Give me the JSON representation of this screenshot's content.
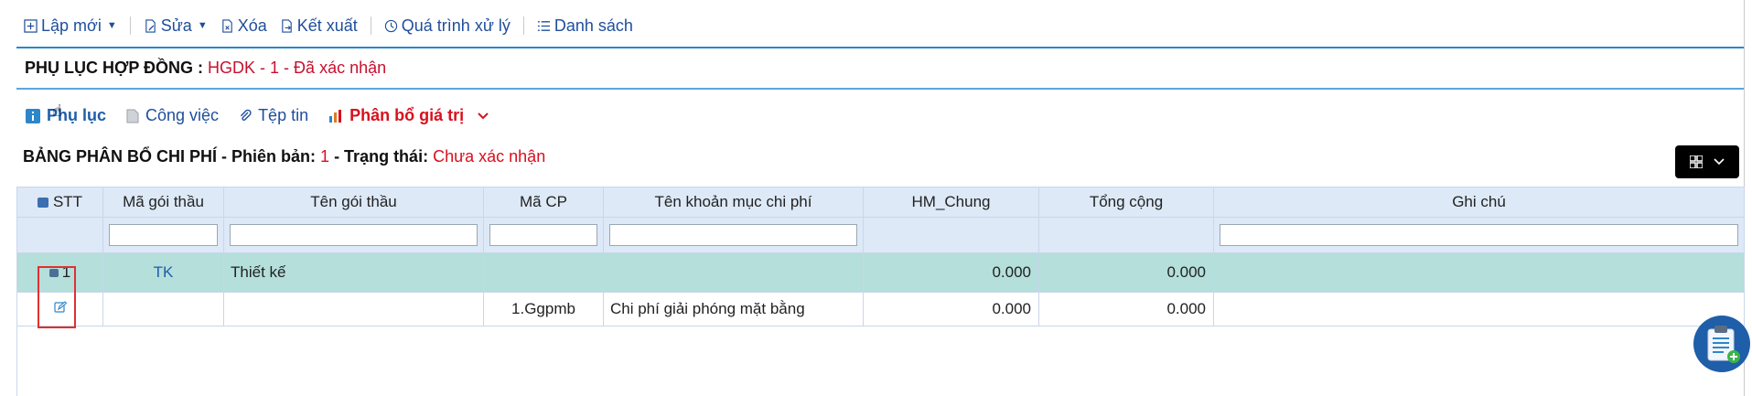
{
  "toolbar": {
    "new_label": "Lập mới",
    "edit_label": "Sửa",
    "delete_label": "Xóa",
    "export_label": "Kết xuất",
    "process_label": "Quá trình xử lý",
    "list_label": "Danh sách"
  },
  "contract": {
    "label": "PHỤ LỤC HỢP ĐỒNG :",
    "value": "HGDK - 1 - Đã xác nhận"
  },
  "tabs": [
    {
      "label": "Phụ lục"
    },
    {
      "label": "Công việc"
    },
    {
      "label": "Tệp tin"
    },
    {
      "label": "Phân bổ giá trị"
    }
  ],
  "panel": {
    "title_prefix": "BẢNG PHÂN BỔ CHI PHÍ - Phiên bản:",
    "version": "1",
    "status_label": "- Trạng thái:",
    "status_value": "Chưa xác nhận"
  },
  "table": {
    "headers": [
      "STT",
      "Mã gói thầu",
      "Tên gói thầu",
      "Mã CP",
      "Tên khoản mục chi phí",
      "HM_Chung",
      "Tổng cộng",
      "Ghi chú"
    ],
    "group_row": {
      "stt": "1",
      "code": "TK",
      "name": "Thiết kế",
      "hm_chung": "0.000",
      "total": "0.000"
    },
    "item_row": {
      "cp_code": "1.Ggpmb",
      "cp_name": "Chi phí giải phóng mặt bằng",
      "hm_chung": "0.000",
      "total": "0.000"
    }
  },
  "colors": {
    "accent": "#1f4e9c",
    "alert": "#d8101e",
    "group_row": "#b4dfdb",
    "header_bg": "#dde9f7"
  }
}
